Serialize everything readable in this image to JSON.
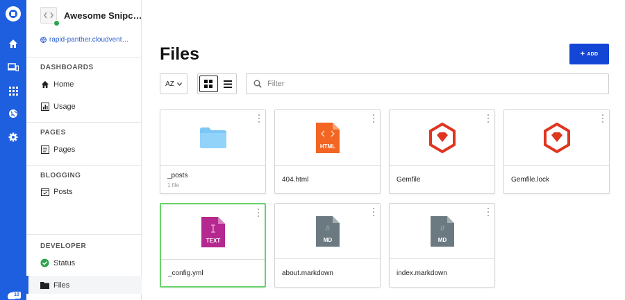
{
  "rail": {
    "icons": [
      "cloudcannon-logo-icon",
      "home-icon",
      "devices-icon",
      "apps-grid-icon",
      "globe-icon",
      "gear-icon"
    ],
    "badge": "10",
    "color": "#1e5fe0"
  },
  "site": {
    "title": "Awesome Snipc…",
    "url": "rapid-panther.cloudvent…"
  },
  "sections": {
    "dashboards": "DASHBOARDS",
    "pages": "PAGES",
    "blogging": "BLOGGING",
    "developer": "DEVELOPER"
  },
  "nav": {
    "home": "Home",
    "usage": "Usage",
    "pages": "Pages",
    "posts": "Posts",
    "status": "Status",
    "files": "Files"
  },
  "main": {
    "title": "Files",
    "add_label": "ADD",
    "sort_label": "AZ",
    "filter_placeholder": "Filter"
  },
  "files": [
    {
      "name": "_posts",
      "sub": "1 file",
      "icon": "folder-icon"
    },
    {
      "name": "404.html",
      "sub": "",
      "icon": "html-file-icon"
    },
    {
      "name": "Gemfile",
      "sub": "",
      "icon": "ruby-gem-icon"
    },
    {
      "name": "Gemfile.lock",
      "sub": "",
      "icon": "ruby-gem-icon"
    },
    {
      "name": "_config.yml",
      "sub": "",
      "icon": "text-file-icon"
    },
    {
      "name": "about.markdown",
      "sub": "",
      "icon": "markdown-file-icon"
    },
    {
      "name": "index.markdown",
      "sub": "",
      "icon": "markdown-file-icon"
    }
  ],
  "file_badges": {
    "html": "HTML",
    "text": "TEXT",
    "md": "MD"
  },
  "colors": {
    "accent": "#1446d6",
    "folder": "#7cc7f5",
    "html": "#f26522",
    "ruby": "#e0351f",
    "text": "#b5288f",
    "markdown": "#6b7a80",
    "selected": "#6ad16a"
  }
}
